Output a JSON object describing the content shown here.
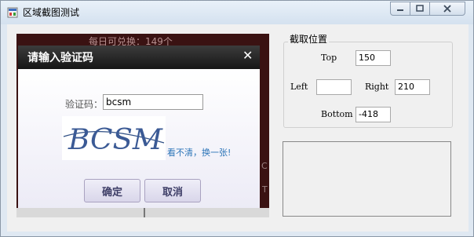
{
  "window": {
    "title": "区域截图测试"
  },
  "dialog": {
    "title": "请输入验证码",
    "label": "验证码：",
    "input_value": "bcsm",
    "captcha_text": "BCSM",
    "refresh_link": "看不清，换一张!",
    "ok_label": "确定",
    "cancel_label": "取消"
  },
  "background": {
    "top_text": "每日可兑换：149个",
    "side_c": "C",
    "side_t": "T"
  },
  "capture_group": {
    "title": "截取位置",
    "top_label": "Top",
    "top_value": "150",
    "left_label": "Left",
    "left_value": "",
    "right_label": "Right",
    "right_value": "210",
    "bottom_label": "Bottom",
    "bottom_value": "-418"
  },
  "icons": {
    "app": "app-icon",
    "close": "close-icon"
  }
}
